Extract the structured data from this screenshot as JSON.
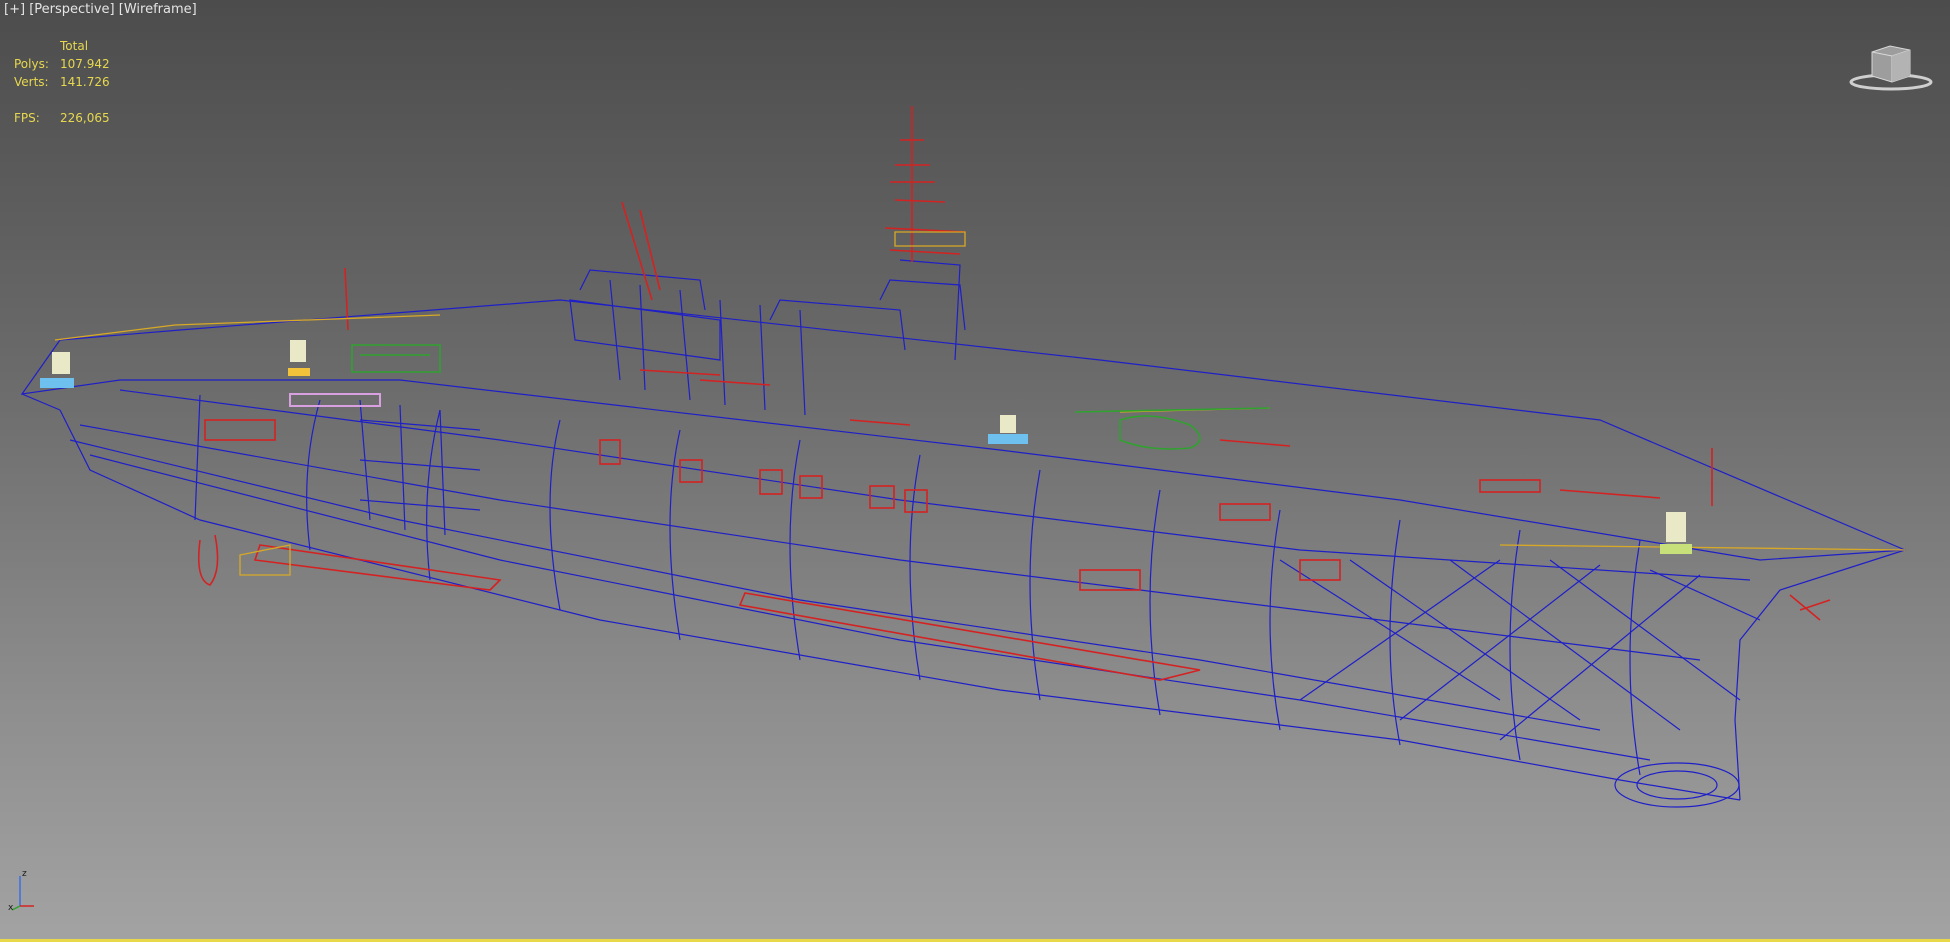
{
  "viewport": {
    "menu_plus": "[+]",
    "view_label": "[Perspective]",
    "shading_label": "[Wireframe]"
  },
  "stats": {
    "header": "Total",
    "polys_label": "Polys:",
    "polys_value": "107.942",
    "verts_label": "Verts:",
    "verts_value": "141.726",
    "fps_label": "FPS:",
    "fps_value": "226,065"
  },
  "axis": {
    "z_label": "z",
    "x_label": "x"
  },
  "colors": {
    "hull_wire": "#1f1fc8",
    "detail_wire": "#d42222",
    "yellow_wire": "#d8a926",
    "green_wire": "#2fa22f",
    "stats_text": "#e7d84e",
    "viewport_border": "#e8d84a"
  },
  "icons": {
    "viewcube": "viewcube-icon",
    "axis": "axis-tripod-icon"
  }
}
